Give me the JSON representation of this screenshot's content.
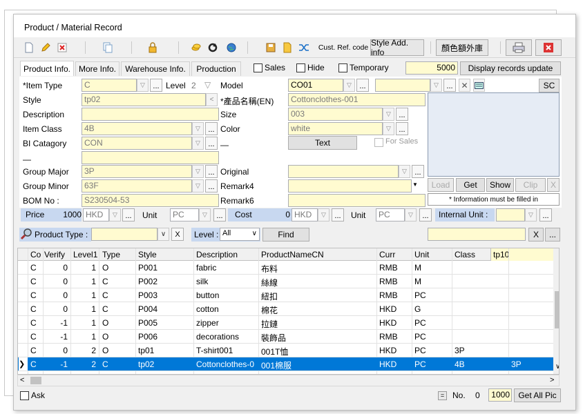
{
  "window": {
    "title": "Product / Material Record"
  },
  "toolbar": {
    "cust_ref_code": "Cust. Ref. code",
    "style_add_info": "Style Add. info",
    "extra_library": "顏色額外庫"
  },
  "tabs": {
    "product_info": "Product Info.",
    "more_info": "More Info.",
    "warehouse_info": "Warehouse Info.",
    "production": "Production",
    "sales": "Sales",
    "hide": "Hide",
    "temporary": "Temporary",
    "records_count": "5000",
    "display_records_update": "Display records update"
  },
  "form": {
    "item_type_label": "*Item Type",
    "item_type": "C",
    "level_label": "Level",
    "level": "2",
    "model_label": "Model",
    "model": "CO01",
    "sc_button": "SC",
    "style_label": "Style",
    "style": "tp02",
    "name_en_label": "*產品名稱(EN)",
    "name_en": "Cottonclothes-001",
    "description_label": "Description",
    "size_label": "Size",
    "size": "003",
    "item_class_label": "Item Class",
    "item_class": "4B",
    "color_label": "Color",
    "color": "white",
    "bi_category_label": "BI Catagory",
    "bi_category": "CON",
    "text_button": "Text",
    "for_sales": "For Sales",
    "dash1": "—",
    "dash2": "—",
    "group_major_label": "Group Major",
    "group_major": "3P",
    "original_label": "Original",
    "group_minor_label": "Group Minor",
    "group_minor": "63F",
    "remark4_label": "Remark4",
    "bom_no_label": "BOM No :",
    "bom_no": "S230504-53",
    "remark6_label": "Remark6",
    "load_button": "Load",
    "get_button": "Get",
    "show_button": "Show",
    "clip_button": "Clip",
    "x_button": "X",
    "info_required": "* Information must be filled in",
    "price_label": "Price",
    "price": "1000",
    "price_currency": "HKD",
    "unit_label": "Unit",
    "unit": "PC",
    "cost_label": "Cost",
    "cost": "0",
    "cost_currency": "HKD",
    "unit2_label": "Unit",
    "unit2": "PC",
    "internal_unit_label": "Internal Unit :"
  },
  "filter": {
    "product_type_label": "Product Type :",
    "clear_button": "X",
    "level_label": "Level :",
    "level_value": "All",
    "find_button": "Find",
    "x_button": "X",
    "ellipsis_button": "..."
  },
  "grid": {
    "headers": [
      "Co",
      "Verify",
      "Level1",
      "Type",
      "Style",
      "Description",
      "ProductNameCN",
      "Curr",
      "Unit",
      "Class",
      "tp10"
    ],
    "rows": [
      [
        "C",
        "0",
        "1",
        "O",
        "P001",
        "fabric",
        "布料",
        "RMB",
        "M",
        "",
        ""
      ],
      [
        "C",
        "0",
        "1",
        "C",
        "P002",
        "silk",
        "絲線",
        "RMB",
        "M",
        "",
        ""
      ],
      [
        "C",
        "0",
        "1",
        "C",
        "P003",
        "button",
        "紐扣",
        "RMB",
        "PC",
        "",
        ""
      ],
      [
        "C",
        "0",
        "1",
        "C",
        "P004",
        "cotton",
        "棉花",
        "HKD",
        "G",
        "",
        ""
      ],
      [
        "C",
        "-1",
        "1",
        "O",
        "P005",
        "zipper",
        "拉鏈",
        "HKD",
        "PC",
        "",
        ""
      ],
      [
        "C",
        "-1",
        "1",
        "O",
        "P006",
        "decorations",
        "裝飾品",
        "RMB",
        "PC",
        "",
        ""
      ],
      [
        "C",
        "0",
        "2",
        "O",
        "tp01",
        "T-shirt001",
        "001T恤",
        "HKD",
        "PC",
        "3P",
        ""
      ],
      [
        "C",
        "-1",
        "2",
        "C",
        "tp02",
        "Cottonclothes-0",
        "001棉服",
        "HKD",
        "PC",
        "4B",
        "3P"
      ]
    ]
  },
  "status": {
    "ask_label": "Ask",
    "no_label": "No.",
    "no_value": "0",
    "page_size": "1000",
    "get_all_pic": "Get All Pic"
  },
  "colors": {
    "required_bg": "#fffbd0",
    "selection": "#0078d7"
  }
}
